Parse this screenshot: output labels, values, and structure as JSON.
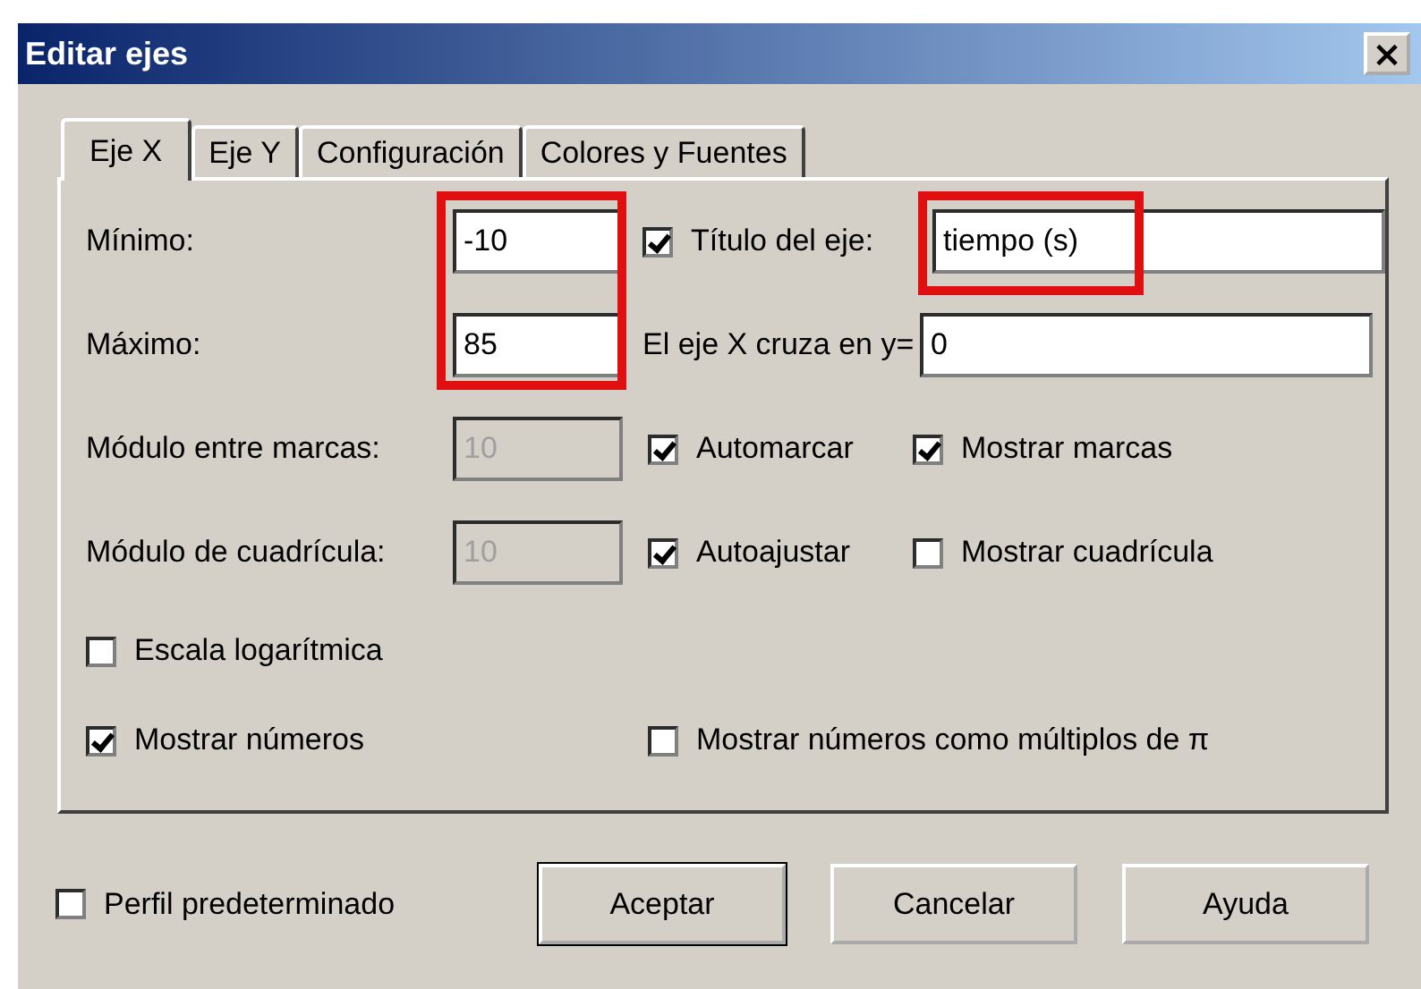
{
  "window": {
    "title": "Editar ejes",
    "close": "×"
  },
  "tabs": [
    {
      "label": "Eje X",
      "selected": true
    },
    {
      "label": "Eje Y",
      "selected": false
    },
    {
      "label": "Configuración",
      "selected": false
    },
    {
      "label": "Colores y Fuentes",
      "selected": false
    }
  ],
  "range": {
    "highlighted": true,
    "minimum": {
      "label": "Mínimo:",
      "value": "-10"
    },
    "maximum": {
      "label": "Máximo:",
      "value": "85"
    }
  },
  "axis_title": {
    "label": "Título del eje:",
    "checked": true,
    "value": "tiempo (s)",
    "highlighted": true
  },
  "crossing": {
    "label": "El eje X cruza en y=",
    "value": "0"
  },
  "spacing_rows": [
    {
      "label": "Módulo entre marcas:",
      "value": "10",
      "disabled": true,
      "options": [
        {
          "label": "Automarcar",
          "checked": true
        },
        {
          "label": "Mostrar marcas",
          "checked": true
        }
      ]
    },
    {
      "label": "Módulo de cuadrícula:",
      "value": "10",
      "disabled": true,
      "options": [
        {
          "label": "Autoajustar",
          "checked": true
        },
        {
          "label": "Mostrar cuadrícula",
          "checked": false
        }
      ]
    }
  ],
  "log_scale": {
    "label": "Escala logarítmica",
    "checked": false
  },
  "number_options": [
    {
      "label": "Mostrar números",
      "checked": true
    },
    {
      "label": "Mostrar números como múltiplos de π",
      "checked": false
    }
  ],
  "default_profile": {
    "label": "Perfil predeterminado",
    "checked": false
  },
  "buttons": [
    {
      "label": "Aceptar",
      "default": true
    },
    {
      "label": "Cancelar",
      "default": false
    },
    {
      "label": "Ayuda",
      "default": false
    }
  ]
}
